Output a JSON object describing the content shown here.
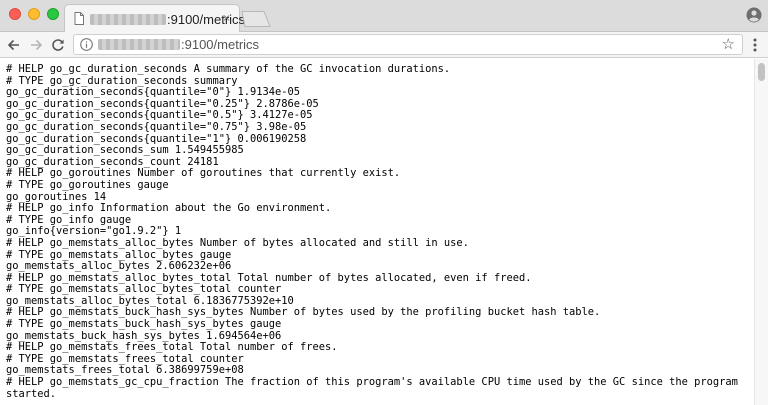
{
  "tab": {
    "title": ":9100/metrics",
    "close": "×"
  },
  "address_bar": {
    "url": ":9100/metrics",
    "star": "☆"
  },
  "icons": {
    "back": "arrow-left-icon",
    "forward": "arrow-right-icon",
    "reload": "reload-icon",
    "info": "info-icon",
    "bookmark": "star-icon",
    "menu": "kebab-menu-icon",
    "profile": "profile-icon"
  },
  "colors": {
    "close_button": "#fd5f57",
    "minimize_button": "#febc2e",
    "zoom_button": "#28c840"
  },
  "lines": [
    "# HELP go_gc_duration_seconds A summary of the GC invocation durations.",
    "# TYPE go_gc_duration_seconds summary",
    "go_gc_duration_seconds{quantile=\"0\"} 1.9134e-05",
    "go_gc_duration_seconds{quantile=\"0.25\"} 2.8786e-05",
    "go_gc_duration_seconds{quantile=\"0.5\"} 3.4127e-05",
    "go_gc_duration_seconds{quantile=\"0.75\"} 3.98e-05",
    "go_gc_duration_seconds{quantile=\"1\"} 0.006190258",
    "go_gc_duration_seconds_sum 1.549455985",
    "go_gc_duration_seconds_count 24181",
    "# HELP go_goroutines Number of goroutines that currently exist.",
    "# TYPE go_goroutines gauge",
    "go_goroutines 14",
    "# HELP go_info Information about the Go environment.",
    "# TYPE go_info gauge",
    "go_info{version=\"go1.9.2\"} 1",
    "# HELP go_memstats_alloc_bytes Number of bytes allocated and still in use.",
    "# TYPE go_memstats_alloc_bytes gauge",
    "go_memstats_alloc_bytes 2.606232e+06",
    "# HELP go_memstats_alloc_bytes_total Total number of bytes allocated, even if freed.",
    "# TYPE go_memstats_alloc_bytes_total counter",
    "go_memstats_alloc_bytes_total 6.1836775392e+10",
    "# HELP go_memstats_buck_hash_sys_bytes Number of bytes used by the profiling bucket hash table.",
    "# TYPE go_memstats_buck_hash_sys_bytes gauge",
    "go_memstats_buck_hash_sys_bytes 1.694564e+06",
    "# HELP go_memstats_frees_total Total number of frees.",
    "# TYPE go_memstats_frees_total counter",
    "go_memstats_frees_total 6.38699759e+08",
    "# HELP go_memstats_gc_cpu_fraction The fraction of this program's available CPU time used by the GC since the program",
    "started."
  ]
}
